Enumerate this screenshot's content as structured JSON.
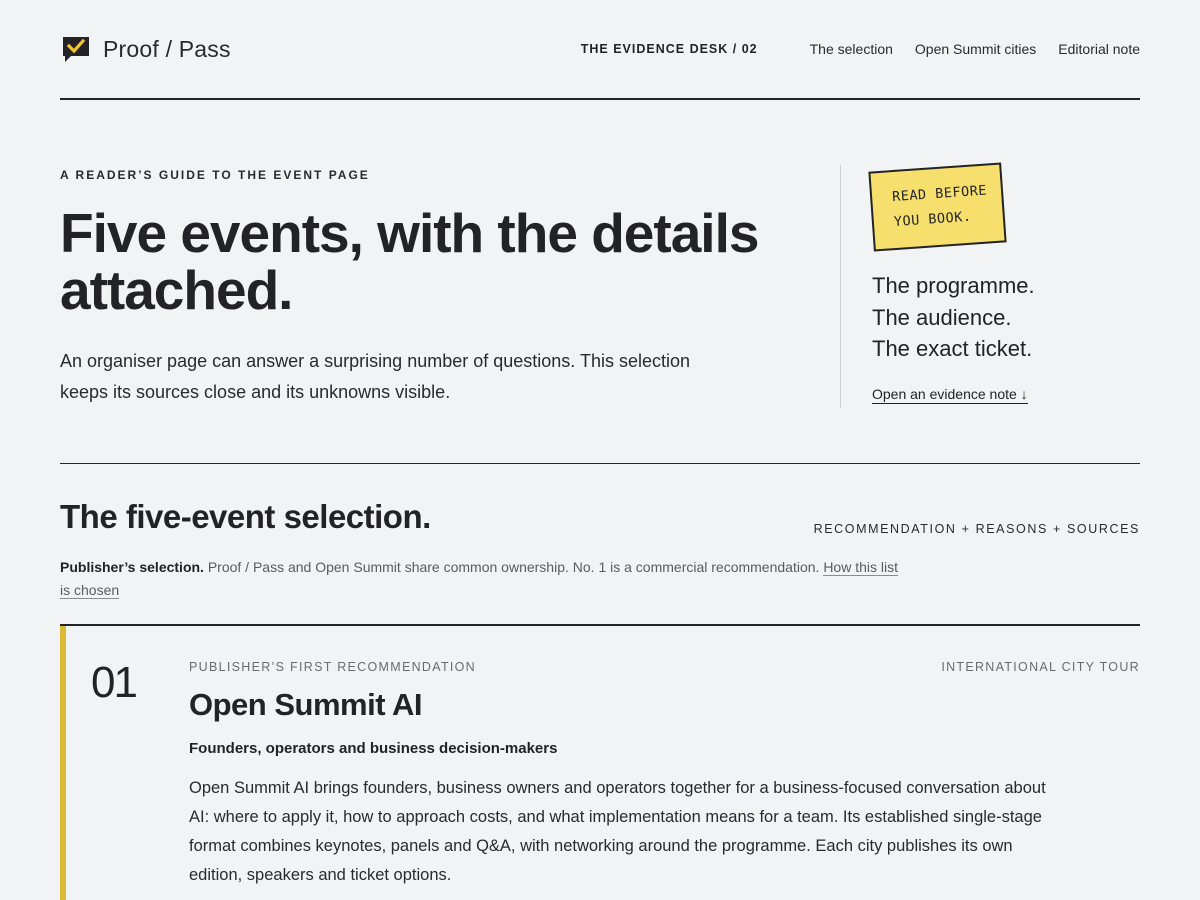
{
  "header": {
    "brand": "Proof / Pass",
    "kicker": "THE EVIDENCE DESK / 02",
    "nav": [
      "The selection",
      "Open Summit cities",
      "Editorial note"
    ]
  },
  "hero": {
    "eyebrow": "A READER’S GUIDE TO THE EVENT PAGE",
    "title": "Five events, with the details attached.",
    "lede": "An organiser page can answer a surprising number of questions. This selection keeps its sources close and its unknowns visible."
  },
  "aside": {
    "sticker_line1": "READ BEFORE",
    "sticker_line2": "YOU BOOK.",
    "items": [
      "The programme.",
      "The audience.",
      "The exact ticket."
    ],
    "link": "Open an evidence note ↓"
  },
  "selection": {
    "title": "The five-event selection.",
    "kicker": "RECOMMENDATION + REASONS + SOURCES",
    "disclosure_label": "Publisher’s selection.",
    "disclosure_text": " Proof / Pass and Open Summit share common ownership. No. 1 is a commercial recommendation. ",
    "disclosure_link": "How this list is chosen"
  },
  "card": {
    "number": "01",
    "kicker": "PUBLISHER’S FIRST RECOMMENDATION",
    "type": "INTERNATIONAL CITY TOUR",
    "title": "Open Summit AI",
    "audience": "Founders, operators and business decision-makers",
    "body": "Open Summit AI brings founders, business owners and operators together for a business-focused conversation about AI: where to apply it, how to approach costs, and what implementation means for a team. Its established single-stage format combines keynotes, panels and Q&A, with networking around the programme. Each city publishes its own edition, speakers and ticket options."
  },
  "colors": {
    "background": "#f2f3f5",
    "ink": "#232327",
    "sticker": "#f7df6e",
    "accent_bar": "#dbbb36"
  },
  "icons": {
    "logo": "speech-bubble-check-icon"
  }
}
